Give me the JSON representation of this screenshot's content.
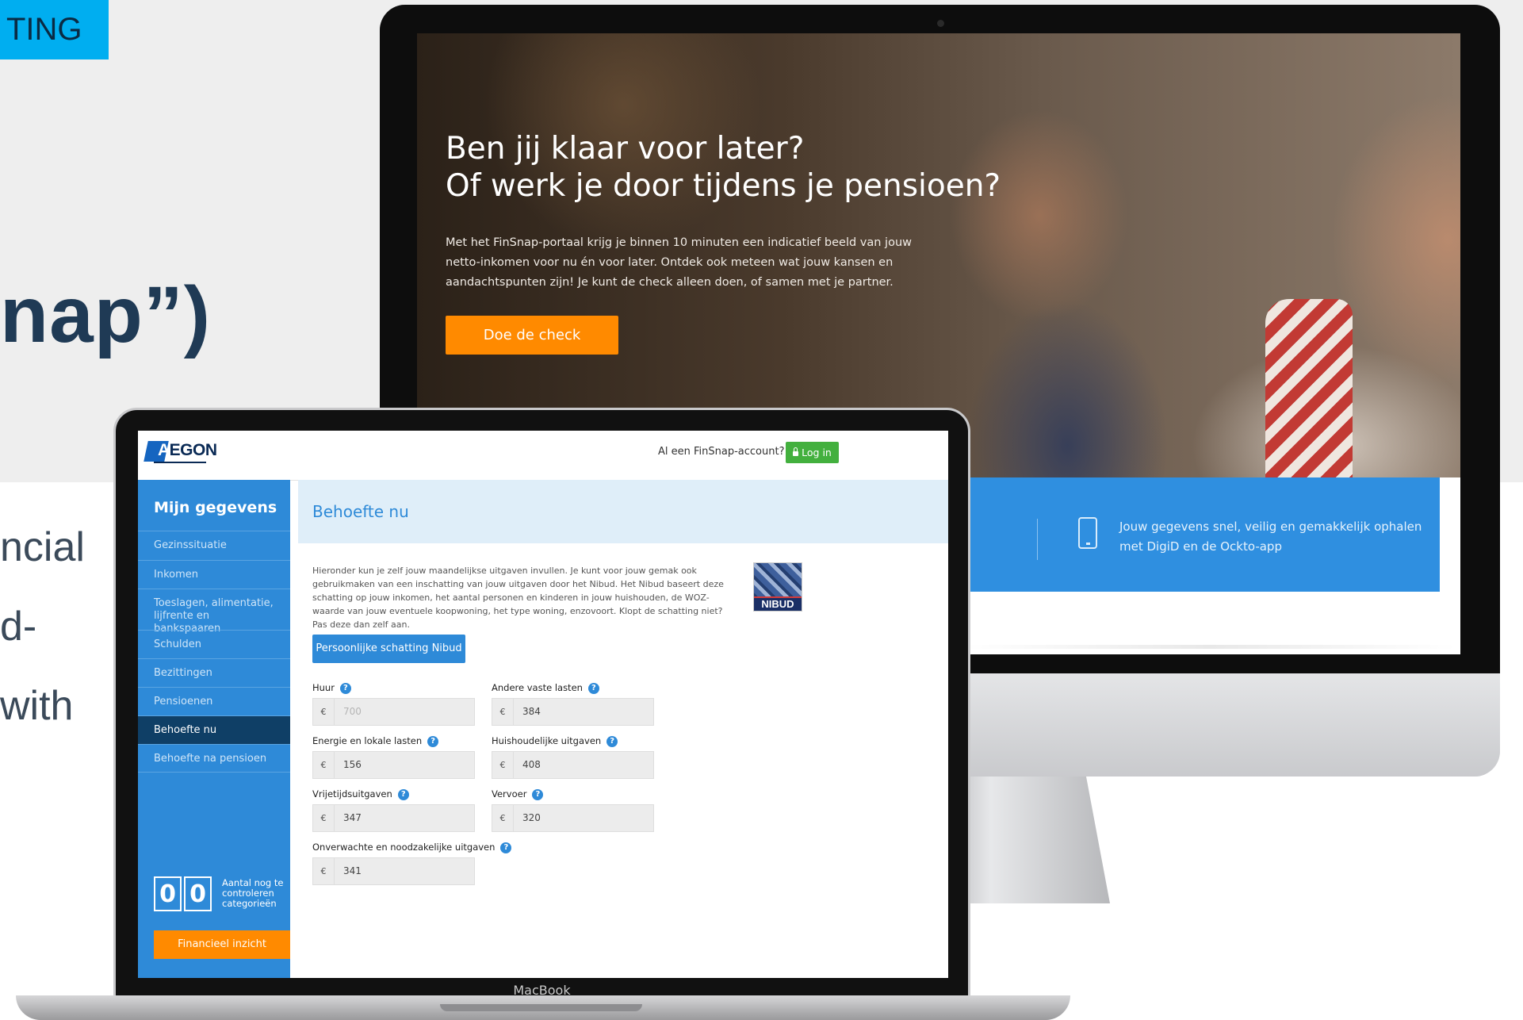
{
  "slide": {
    "tag_label": "TING",
    "heading_fragment": "nap”)",
    "body_fragments": [
      "ncial",
      "d-",
      "with"
    ]
  },
  "imac": {
    "hero": {
      "title_line1": "Ben jij klaar voor later?",
      "title_line2": "Of werk je door tijdens je pensioen?",
      "text": "Met het FinSnap-portaal krijg je binnen 10 minuten een indicatief beeld van jouw netto-inkomen voor nu én voor later. Ontdek ook meteen wat jouw kansen en aandachtspunten zijn! Je kunt de check alleen doen, of samen met je partner.",
      "cta_label": "Doe de check"
    },
    "info": {
      "text": "Jouw gegevens snel, veilig en gemakkelijk ophalen met DigiD en de Ockto-app",
      "icon": "smartphone-icon"
    }
  },
  "macbook": {
    "brand": "MacBook",
    "header": {
      "logo_text_first": "A",
      "logo_text_rest": "EGON",
      "account_question": "Al een FinSnap-account?",
      "login_label": "Log in"
    },
    "sidebar": {
      "title": "Mijn gegevens",
      "items": [
        {
          "label": "Gezinssituatie"
        },
        {
          "label": "Inkomen"
        },
        {
          "label": "Toeslagen, alimentatie, lijfrente en bankspaaren"
        },
        {
          "label": "Schulden"
        },
        {
          "label": "Bezittingen"
        },
        {
          "label": "Pensioenen"
        },
        {
          "label": "Behoefte nu"
        },
        {
          "label": "Behoefte na pensioen"
        }
      ],
      "counter_digits": [
        "0",
        "0"
      ],
      "counter_label": "Aantal nog te controleren categorieën",
      "financial_button": "Financieel inzicht"
    },
    "content": {
      "title": "Behoefte nu",
      "intro": "Hieronder kun je zelf jouw maandelijkse uitgaven invullen. Je kunt voor jouw gemak ook gebruikmaken van een inschatting van jouw uitgaven door het Nibud. Het Nibud baseert deze schatting op jouw inkomen, het aantal personen en kinderen in jouw huishouden, de WOZ-waarde van jouw eventuele koopwoning, het type woning, enzovoort. Klopt de schatting niet? Pas deze dan zelf aan.",
      "nibud_label": "NIBUD",
      "nibud_button": "Persoonlijke schatting Nibud",
      "currency": "€",
      "help_glyph": "?",
      "fields": {
        "huur": {
          "label": "Huur",
          "value": "700"
        },
        "andere": {
          "label": "Andere vaste lasten",
          "value": "384"
        },
        "energie": {
          "label": "Energie en lokale lasten",
          "value": "156"
        },
        "huishoud": {
          "label": "Huishoudelijke uitgaven",
          "value": "408"
        },
        "vrije": {
          "label": "Vrijetijdsuitgaven",
          "value": "347"
        },
        "vervoer": {
          "label": "Vervoer",
          "value": "320"
        },
        "onverwacht": {
          "label": "Onverwachte en noodzakelijke uitgaven",
          "value": "341"
        }
      }
    }
  },
  "colors": {
    "accent_blue": "#2e8ad8",
    "cta_orange": "#ff8a00",
    "login_green": "#43b03e",
    "active_nav": "#0f3f66"
  }
}
